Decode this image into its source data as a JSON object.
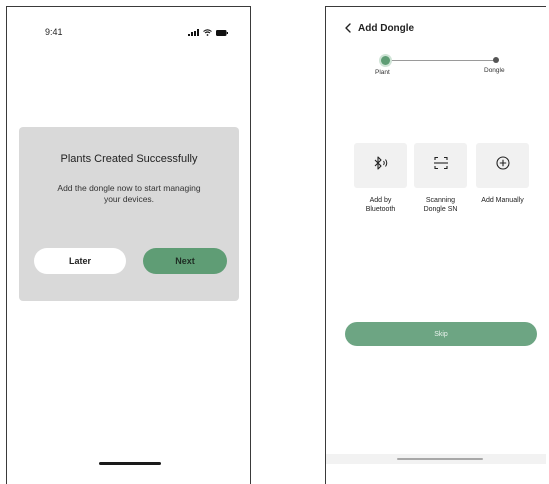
{
  "left_screen": {
    "status_bar": {
      "time": "9:41"
    },
    "dialog": {
      "title": "Plants Created Successfully",
      "message": "Add the dongle now to start managing your devices.",
      "later_label": "Later",
      "next_label": "Next"
    }
  },
  "right_screen": {
    "header": {
      "back_icon": "chevron-left-icon",
      "title": "Add Dongle"
    },
    "stepper": {
      "steps": [
        {
          "label": "Plant",
          "state": "active"
        },
        {
          "label": "Dongle",
          "state": "pending"
        }
      ]
    },
    "options": [
      {
        "icon": "bluetooth-icon",
        "label": "Add by Bluetooth"
      },
      {
        "icon": "scan-icon",
        "label": "Scanning Dongle SN"
      },
      {
        "icon": "plus-circle-icon",
        "label": "Add Manually"
      }
    ],
    "skip_label": "Skip"
  },
  "colors": {
    "accent_green": "#5f9d75",
    "dialog_bg": "#d9d9d9",
    "card_bg": "#f1f1f1"
  }
}
